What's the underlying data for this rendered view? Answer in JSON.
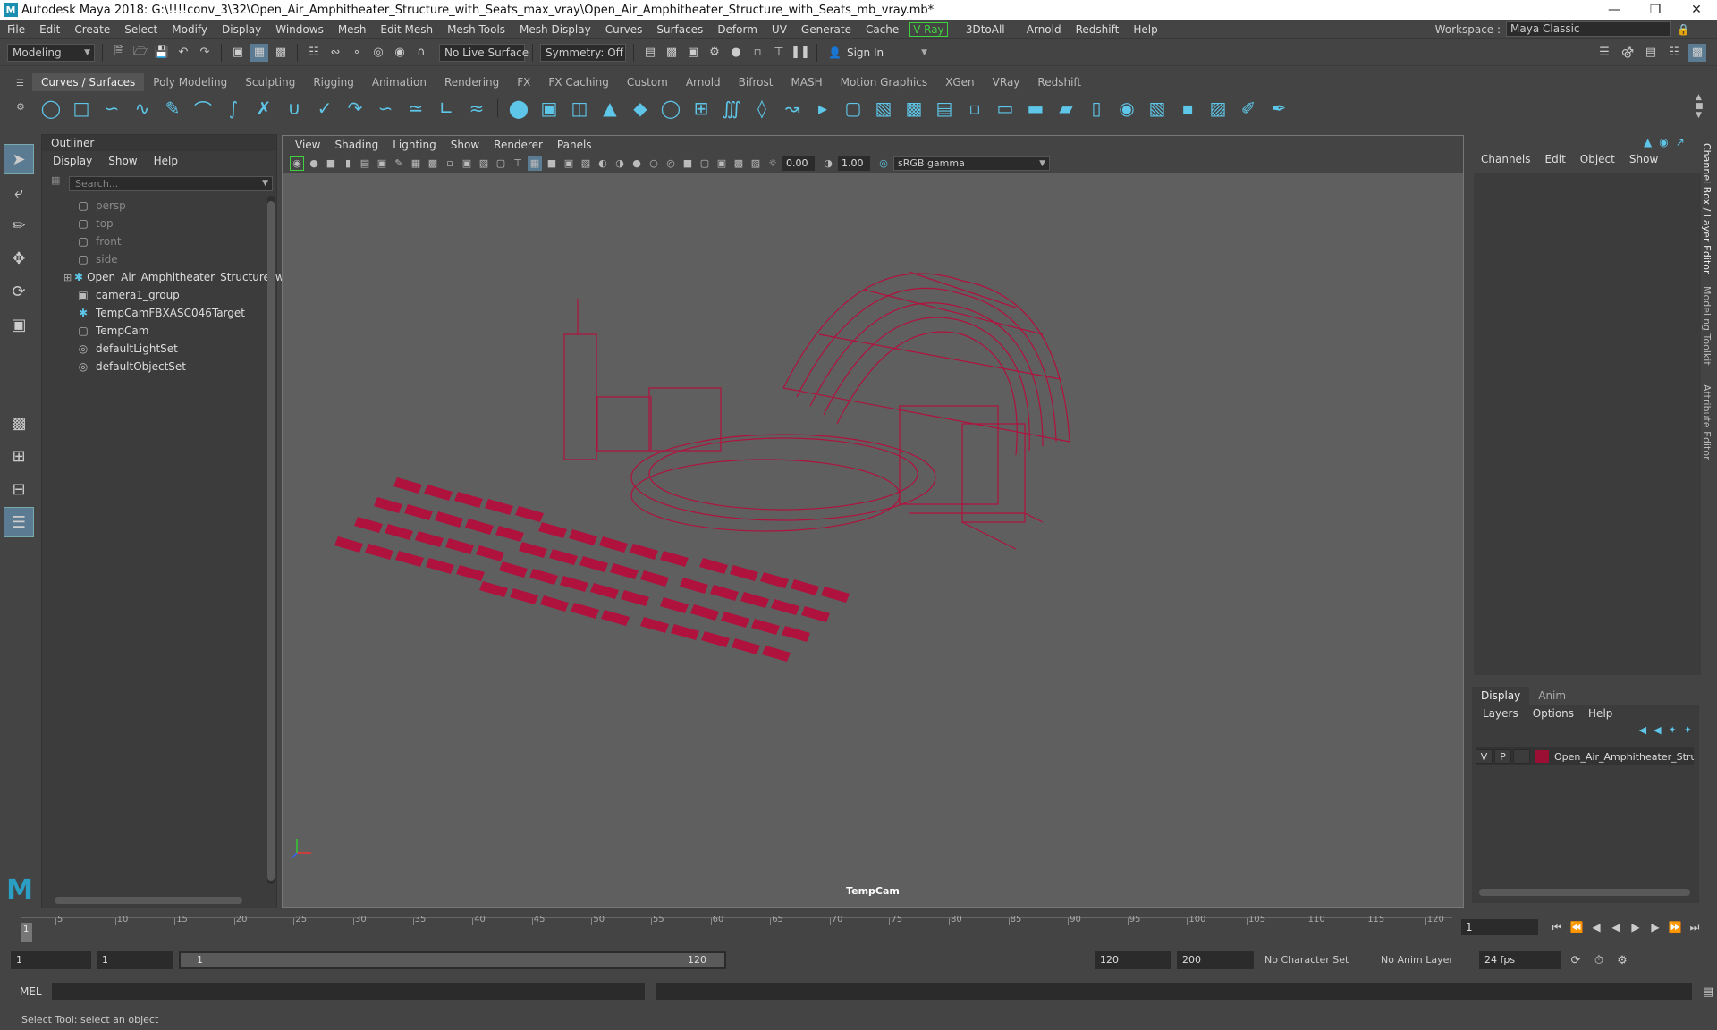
{
  "title_bar": {
    "app_title": "Autodesk Maya 2018: G:\\!!!!conv_3\\32\\Open_Air_Amphitheater_Structure_with_Seats_max_vray\\Open_Air_Amphitheater_Structure_with_Seats_mb_vray.mb*",
    "logo_letter": "M"
  },
  "menubar": {
    "items": [
      "File",
      "Edit",
      "Create",
      "Select",
      "Modify",
      "Display",
      "Windows",
      "Mesh",
      "Edit Mesh",
      "Mesh Tools",
      "Mesh Display",
      "Curves",
      "Surfaces",
      "Deform",
      "UV",
      "Generate",
      "Cache",
      "V-Ray",
      "- 3DtoAll -",
      "Arnold",
      "Redshift",
      "Help"
    ],
    "workspace_label": "Workspace :",
    "workspace_value": "Maya Classic"
  },
  "statusline": {
    "mode": "Modeling",
    "live_surface": "No Live Surface",
    "symmetry": "Symmetry: Off",
    "sign_in": "Sign In"
  },
  "shelf": {
    "tabs": [
      "Curves / Surfaces",
      "Poly Modeling",
      "Sculpting",
      "Rigging",
      "Animation",
      "Rendering",
      "FX",
      "FX Caching",
      "Custom",
      "Arnold",
      "Bifrost",
      "MASH",
      "Motion Graphics",
      "XGen",
      "VRay",
      "Redshift"
    ],
    "active_tab": "Curves / Surfaces"
  },
  "outliner": {
    "title": "Outliner",
    "menu": [
      "Display",
      "Show",
      "Help"
    ],
    "search_placeholder": "Search...",
    "items": [
      {
        "label": "persp",
        "icon": "camera-icon",
        "dim": true
      },
      {
        "label": "top",
        "icon": "camera-icon",
        "dim": true
      },
      {
        "label": "front",
        "icon": "camera-icon",
        "dim": true
      },
      {
        "label": "side",
        "icon": "camera-icon",
        "dim": true
      },
      {
        "label": "Open_Air_Amphitheater_Structure_w",
        "icon": "group-icon",
        "dim": false,
        "expandable": true
      },
      {
        "label": "camera1_group",
        "icon": "group-icon",
        "dim": false
      },
      {
        "label": "TempCamFBXASC046Target",
        "icon": "locator-icon",
        "dim": false
      },
      {
        "label": "TempCam",
        "icon": "camera-icon",
        "dim": false
      },
      {
        "label": "defaultLightSet",
        "icon": "set-icon",
        "dim": false
      },
      {
        "label": "defaultObjectSet",
        "icon": "set-icon",
        "dim": false
      }
    ]
  },
  "viewport": {
    "menu": [
      "View",
      "Shading",
      "Lighting",
      "Show",
      "Renderer",
      "Panels"
    ],
    "exposure": "0.00",
    "gamma": "1.00",
    "color_space": "sRGB gamma",
    "camera_label": "TempCam",
    "wire_color": "#b0123e"
  },
  "channel_box": {
    "menu": [
      "Channels",
      "Edit",
      "Object",
      "Show"
    ],
    "side_tabs": [
      "Channel Box / Layer Editor",
      "Modeling Toolkit",
      "Attribute Editor"
    ]
  },
  "layer_editor": {
    "tabs": [
      "Display",
      "Anim"
    ],
    "active_tab": "Display",
    "menu": [
      "Layers",
      "Options",
      "Help"
    ],
    "layer": {
      "v": "V",
      "p": "P",
      "name": "Open_Air_Amphitheater_Struc",
      "color": "#9a0f33"
    }
  },
  "timeline": {
    "ticks": [
      "5",
      "10",
      "15",
      "20",
      "25",
      "30",
      "35",
      "40",
      "45",
      "50",
      "55",
      "60",
      "65",
      "70",
      "75",
      "80",
      "85",
      "90",
      "95",
      "100",
      "105",
      "110",
      "115",
      "120"
    ],
    "start_tick": "1",
    "current_frame": "1"
  },
  "range": {
    "start": "1",
    "playback_start": "1",
    "range_start_label": "1",
    "range_end_label": "120",
    "playback_end": "120",
    "end": "200",
    "character_set": "No Character Set",
    "anim_layer": "No Anim Layer",
    "fps": "24 fps"
  },
  "command": {
    "label": "MEL"
  },
  "helpline": {
    "text": "Select Tool: select an object"
  }
}
